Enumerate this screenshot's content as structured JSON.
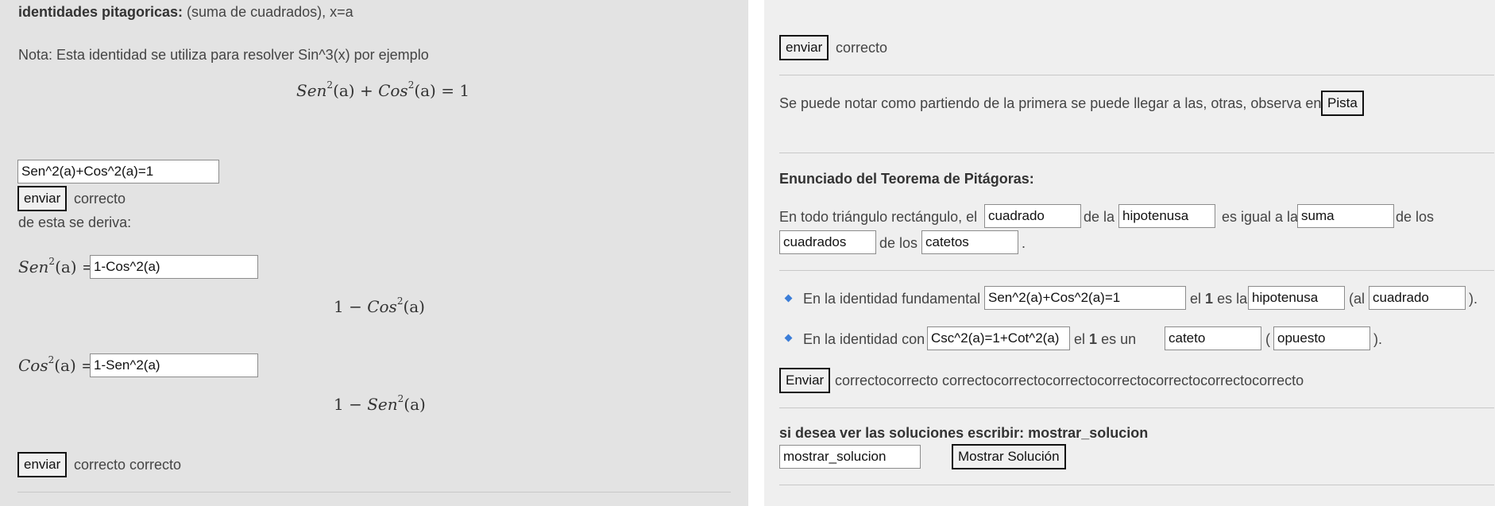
{
  "left": {
    "heading": "identidades pitagoricas:",
    "heading_rest": " (suma de cuadrados), x=a",
    "note": "Nota: Esta identidad se utiliza para resolver Sin^3(x) por ejemplo",
    "main_identity": {
      "lhs1": "Sen",
      "exp1": "2",
      "arg1": "(a) + ",
      "lhs2": "Cos",
      "exp2": "2",
      "arg2": "(a) = 1"
    },
    "input1_value": "Sen^2(a)+Cos^2(a)=1",
    "send_label": "enviar",
    "status1": "correcto",
    "derive_text": "de esta se deriva:",
    "sen_label": {
      "fn": "Sen",
      "exp": "2",
      "arg": "(a)",
      "eq": " ="
    },
    "input_sen_value": "1-Cos^2(a)",
    "result_sen": {
      "pre": "1 − ",
      "fn": "Cos",
      "exp": "2",
      "arg": "(a)"
    },
    "cos_label": {
      "fn": "Cos",
      "exp": "2",
      "arg": "(a)",
      "eq": " ="
    },
    "input_cos_value": "1-Sen^2(a)",
    "result_cos": {
      "pre": "1 − ",
      "fn": "Sen",
      "exp": "2",
      "arg": "(a)"
    },
    "status2": "correcto correcto"
  },
  "right": {
    "send_label": "enviar",
    "status_top": "correcto",
    "note_text": "Se puede notar como partiendo de la primera se puede llegar a las, otras, observa en:",
    "hint_label": "Pista",
    "theorem_title": "Enunciado del Teorema de Pitágoras:",
    "theorem": {
      "t1": "En todo triángulo rectángulo, el",
      "v1": "cuadrado",
      "t2": "de la",
      "v2": "hipotenusa",
      "t3": "es igual a la",
      "v3": "suma",
      "t4": "de los",
      "v4": "cuadrados",
      "t5": "de los",
      "v5": "catetos",
      "t6": "."
    },
    "bullet1": {
      "t1": "En la identidad fundamental",
      "v1": "Sen^2(a)+Cos^2(a)=1",
      "t2": "el",
      "one": "1",
      "t3": "es la",
      "v2": "hipotenusa",
      "t4": "(al",
      "v3": "cuadrado",
      "t5": ")."
    },
    "bullet2": {
      "t1": "En la identidad con",
      "v1": "Csc^2(a)=1+Cot^2(a)",
      "t2": "el",
      "one": "1",
      "t3": "es un",
      "v2": "cateto",
      "t4": "(",
      "v3": "opuesto",
      "t5": ")."
    },
    "enviar_label": "Enviar",
    "status_bottom": "correctocorrecto correctocorrectocorrectocorrectocorrectocorrectocorrecto",
    "solution_prompt": "si desea ver las soluciones escribir: mostrar_solucion",
    "solution_input": "mostrar_solucion",
    "show_solution_label": "Mostrar Solución"
  }
}
